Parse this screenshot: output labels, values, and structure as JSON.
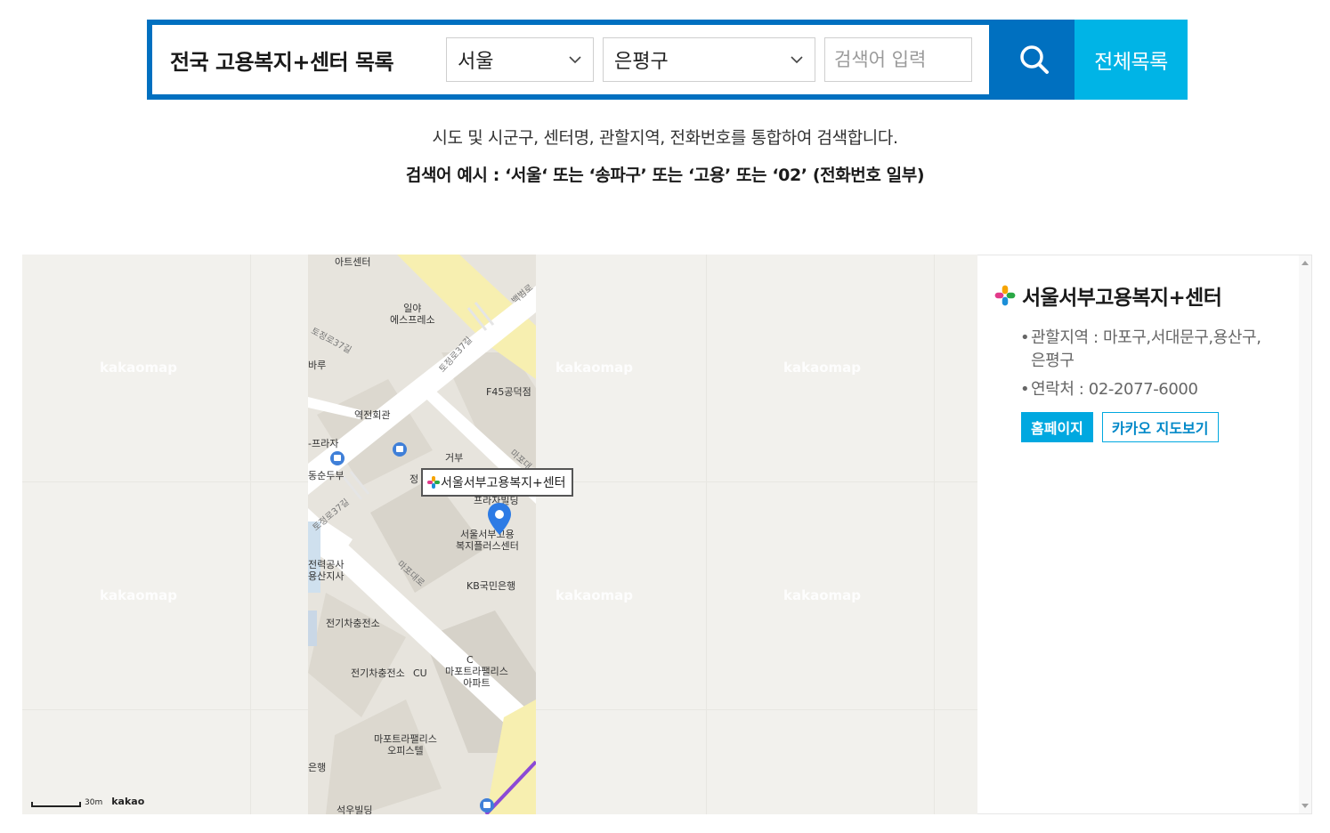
{
  "search": {
    "title": "전국 고용복지+센터 목록",
    "sido_value": "서울",
    "gu_value": "은평구",
    "keyword_placeholder": "검색어 입력",
    "all_list_label": "전체목록"
  },
  "help": {
    "line1": "시도 및 시군구, 센터명, 관할지역, 전화번호를 통합하여 검색합니다.",
    "line2": "검색어 예시 : ‘서울‘ 또는 ‘송파구’ 또는 ‘고용’ 또는 ‘02’ (전화번호 일부)"
  },
  "map": {
    "watermark": "kakaomap",
    "tooltip": "서울서부고용복지+센터",
    "scale_label": "30m",
    "provider": "kakao",
    "pois": [
      "아트센터",
      "일야\n에스프레소",
      "F45공덕점",
      "역전회관",
      "-프라자",
      "거부",
      "동순두부",
      "정",
      "프라자빌딩",
      "서울서부고용\n복지플러스센터",
      "KB국민은행",
      "전력공사\n용산지사",
      "전기차충전소",
      "전기차충전소",
      "CU",
      "마포트라팰리스\n아파트",
      "마포트라팰리스\n오피스텔",
      "은행",
      "석우빌딩",
      "바루",
      "C"
    ],
    "roads": [
      "토정로37길",
      "토정로37길",
      "마포대로",
      "마포대",
      "토정로37길",
      "백범로"
    ]
  },
  "center": {
    "name": "서울서부고용복지+센터",
    "area": "관할지역 : 마포구,서대문구,용산구, 은평구",
    "contact": "연락처 : 02-2077-6000",
    "homepage_label": "홈페이지",
    "kakao_map_label": "카카오 지도보기"
  },
  "colors": {
    "primary": "#0070c0",
    "accent": "#00b4e6",
    "button": "#00a8e0"
  }
}
